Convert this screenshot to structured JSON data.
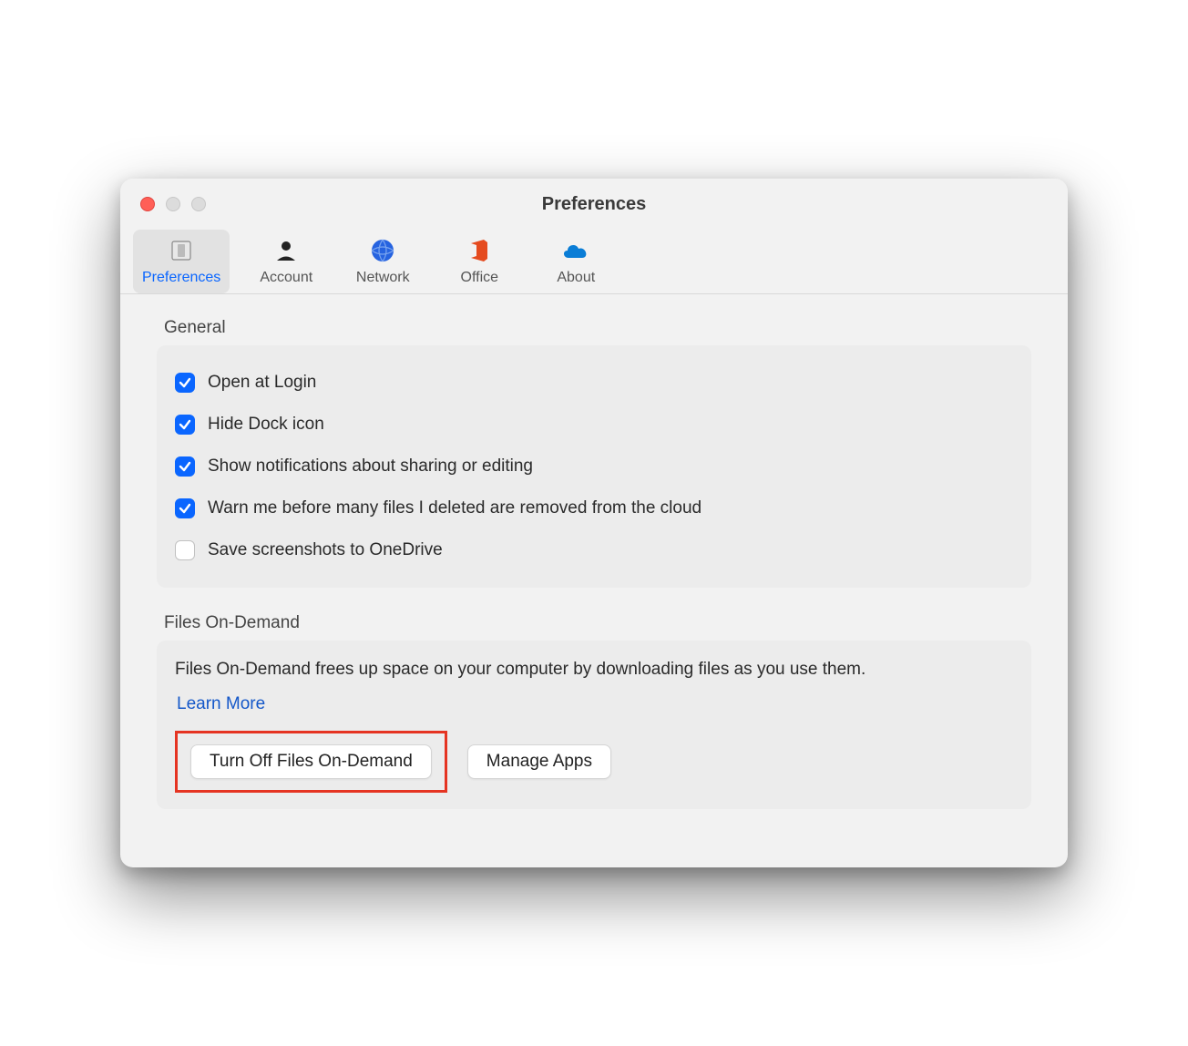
{
  "window": {
    "title": "Preferences"
  },
  "toolbar": {
    "items": [
      {
        "label": "Preferences",
        "icon": "preferences-icon",
        "active": true
      },
      {
        "label": "Account",
        "icon": "account-icon",
        "active": false
      },
      {
        "label": "Network",
        "icon": "network-icon",
        "active": false
      },
      {
        "label": "Office",
        "icon": "office-icon",
        "active": false
      },
      {
        "label": "About",
        "icon": "about-icon",
        "active": false
      }
    ]
  },
  "sections": {
    "general": {
      "title": "General",
      "checkboxes": [
        {
          "label": "Open at Login",
          "checked": true
        },
        {
          "label": "Hide Dock icon",
          "checked": true
        },
        {
          "label": "Show notifications about sharing or editing",
          "checked": true
        },
        {
          "label": "Warn me before many files I deleted are removed from the cloud",
          "checked": true
        },
        {
          "label": "Save screenshots to OneDrive",
          "checked": false
        }
      ]
    },
    "filesOnDemand": {
      "title": "Files On-Demand",
      "description": "Files On-Demand frees up space on your computer by downloading files as you use them.",
      "learnMore": "Learn More",
      "turnOffLabel": "Turn Off Files On-Demand",
      "manageAppsLabel": "Manage Apps"
    }
  },
  "colors": {
    "accent": "#0a66ff",
    "highlight": "#e53422",
    "link": "#1558c9"
  }
}
